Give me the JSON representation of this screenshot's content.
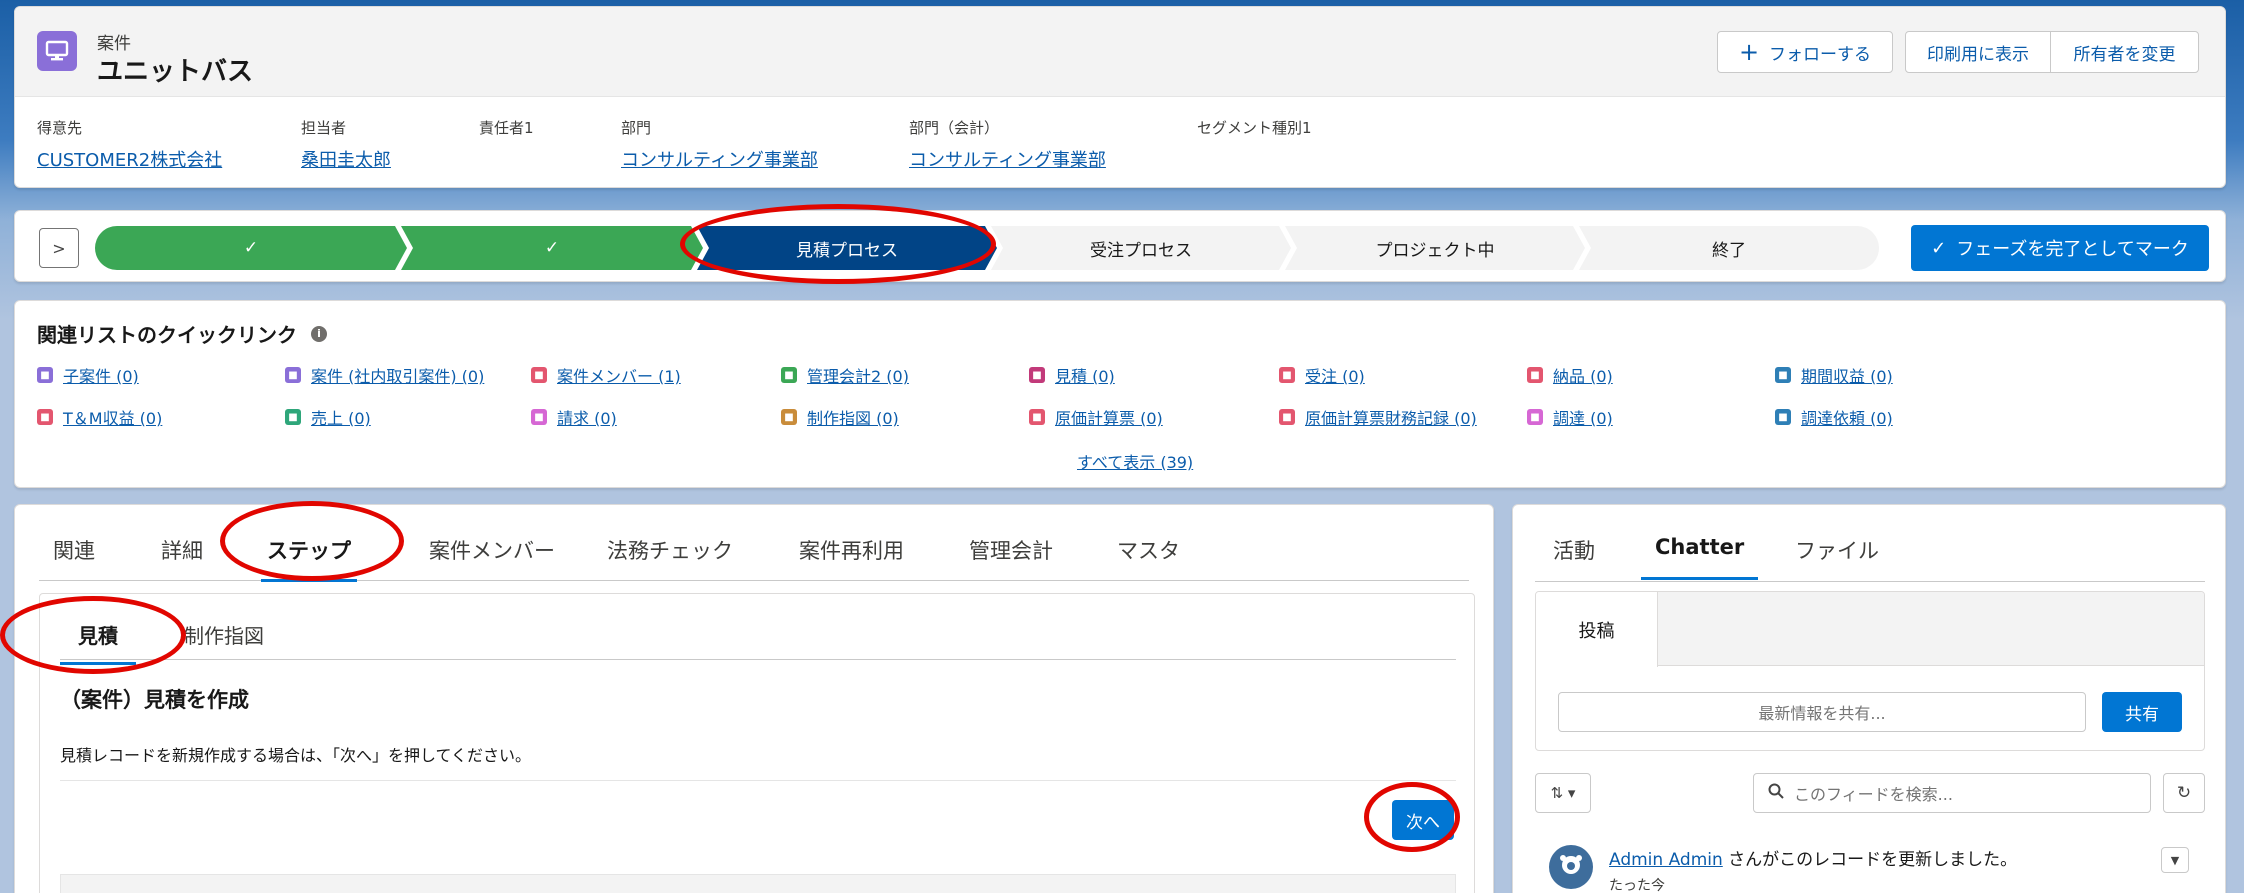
{
  "header": {
    "object_type": "案件",
    "record_name": "ユニットバス",
    "buttons": {
      "follow": "フォローする",
      "print": "印刷用に表示",
      "change_owner": "所有者を変更"
    },
    "fields": [
      {
        "label": "得意先",
        "value": "CUSTOMER2株式会社",
        "link": true
      },
      {
        "label": "担当者",
        "value": "桑田圭太郎",
        "link": true
      },
      {
        "label": "責任者1",
        "value": "",
        "link": false
      },
      {
        "label": "部門",
        "value": "コンサルティング事業部",
        "link": true
      },
      {
        "label": "部門（会計）",
        "value": "コンサルティング事業部",
        "link": true
      },
      {
        "label": "セグメント種別1",
        "value": "",
        "link": false
      }
    ]
  },
  "path": {
    "stages": [
      {
        "label": "✓",
        "status": "complete"
      },
      {
        "label": "✓",
        "status": "complete"
      },
      {
        "label": "見積プロセス",
        "status": "current"
      },
      {
        "label": "受注プロセス",
        "status": "incomplete"
      },
      {
        "label": "プロジェクト中",
        "status": "incomplete"
      },
      {
        "label": "終了",
        "status": "incomplete"
      }
    ],
    "mark_complete": "フェーズを完了としてマーク"
  },
  "quick_links": {
    "title": "関連リストのクイックリンク",
    "items": [
      {
        "label": "子案件 (0)",
        "color": "#8a6fd8",
        "icon": "case-icon"
      },
      {
        "label": "案件 (社内取引案件) (0)",
        "color": "#8a6fd8",
        "icon": "case-icon"
      },
      {
        "label": "案件メンバー (1)",
        "color": "#e3566f",
        "icon": "member-icon"
      },
      {
        "label": "管理会計2 (0)",
        "color": "#3ba755",
        "icon": "accounting-icon"
      },
      {
        "label": "見積 (0)",
        "color": "#c23a7a",
        "icon": "quote-icon"
      },
      {
        "label": "受注 (0)",
        "color": "#e3566f",
        "icon": "order-icon"
      },
      {
        "label": "納品 (0)",
        "color": "#e3566f",
        "icon": "delivery-icon"
      },
      {
        "label": "期間収益 (0)",
        "color": "#2e7fb6",
        "icon": "revenue-icon"
      },
      {
        "label": "T＆M収益 (0)",
        "color": "#e3566f",
        "icon": "tm-revenue-icon"
      },
      {
        "label": "売上 (0)",
        "color": "#2ea67a",
        "icon": "sales-icon"
      },
      {
        "label": "請求 (0)",
        "color": "#d667d4",
        "icon": "invoice-icon"
      },
      {
        "label": "制作指図 (0)",
        "color": "#c98c3a",
        "icon": "work-order-icon"
      },
      {
        "label": "原価計算票 (0)",
        "color": "#e3566f",
        "icon": "cost-sheet-icon"
      },
      {
        "label": "原価計算票財務記録 (0)",
        "color": "#e3566f",
        "icon": "cost-finance-icon"
      },
      {
        "label": "調達 (0)",
        "color": "#d667d4",
        "icon": "procurement-icon"
      },
      {
        "label": "調達依頼 (0)",
        "color": "#2e7fb6",
        "icon": "procurement-request-icon"
      }
    ],
    "show_all": "すべて表示 (39)"
  },
  "left_panel": {
    "tabs": [
      "関連",
      "詳細",
      "ステップ",
      "案件メンバー",
      "法務チェック",
      "案件再利用",
      "管理会計",
      "マスタ"
    ],
    "active_tab": "ステップ",
    "subtabs": [
      "見積",
      "制作指図"
    ],
    "active_subtab": "見積",
    "step_title": "（案件）見積を作成",
    "step_description": "見積レコードを新規作成する場合は、「次へ」を押してください。",
    "next_button": "次へ"
  },
  "right_panel": {
    "tabs": [
      "活動",
      "Chatter",
      "ファイル"
    ],
    "active_tab": "Chatter",
    "post_tab": "投稿",
    "share_placeholder": "最新情報を共有...",
    "share_button": "共有",
    "search_placeholder": "このフィードを検索...",
    "feed": {
      "user": "Admin Admin",
      "message": " さんがこのレコードを更新しました。",
      "time": "たった今"
    }
  },
  "colors": {
    "path_complete": "#3ba755",
    "path_current": "#014486",
    "brand": "#0176d3",
    "highlight_ring": "#e10600"
  }
}
